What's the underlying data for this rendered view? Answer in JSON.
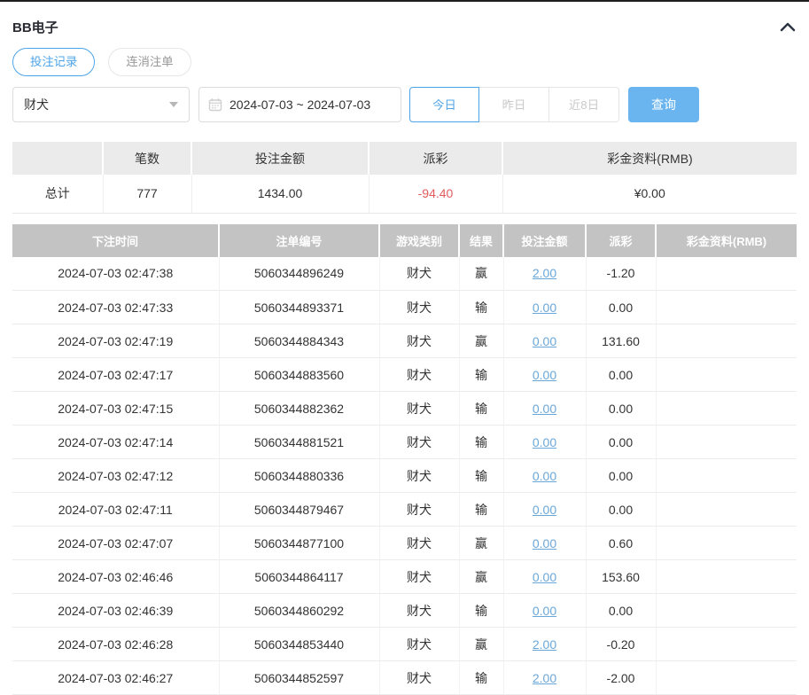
{
  "panel": {
    "title": "BB电子",
    "collapse_icon": "chevron-up-icon"
  },
  "tabs": [
    {
      "label": "投注记录",
      "active": true
    },
    {
      "label": "连消注单",
      "active": false
    }
  ],
  "filters": {
    "game_select": {
      "value": "财犬",
      "icon": "caret-down-icon"
    },
    "date_range": {
      "value": "2024-07-03 ~ 2024-07-03",
      "icon": "calendar-icon"
    },
    "quick_ranges": [
      {
        "label": "今日",
        "active": true
      },
      {
        "label": "昨日",
        "active": false
      },
      {
        "label": "近8日",
        "active": false
      }
    ],
    "search_button_label": "查询"
  },
  "summary": {
    "headers": [
      "",
      "笔数",
      "投注金额",
      "派彩",
      "彩金资料(RMB)"
    ],
    "row": {
      "label": "总计",
      "count": "777",
      "bet_amount": "1434.00",
      "payout": "-94.40",
      "bonus": "¥0.00"
    }
  },
  "records": {
    "headers": [
      "下注时间",
      "注单编号",
      "游戏类别",
      "结果",
      "投注金额",
      "派彩",
      "彩金资料(RMB)"
    ],
    "rows": [
      {
        "time": "2024-07-03 02:47:38",
        "order_id": "5060344896249",
        "game": "财犬",
        "result": "赢",
        "bet_amount": "2.00",
        "payout": "-1.20",
        "bonus": ""
      },
      {
        "time": "2024-07-03 02:47:33",
        "order_id": "5060344893371",
        "game": "财犬",
        "result": "输",
        "bet_amount": "0.00",
        "payout": "0.00",
        "bonus": ""
      },
      {
        "time": "2024-07-03 02:47:19",
        "order_id": "5060344884343",
        "game": "财犬",
        "result": "赢",
        "bet_amount": "0.00",
        "payout": "131.60",
        "bonus": ""
      },
      {
        "time": "2024-07-03 02:47:17",
        "order_id": "5060344883560",
        "game": "财犬",
        "result": "输",
        "bet_amount": "0.00",
        "payout": "0.00",
        "bonus": ""
      },
      {
        "time": "2024-07-03 02:47:15",
        "order_id": "5060344882362",
        "game": "财犬",
        "result": "输",
        "bet_amount": "0.00",
        "payout": "0.00",
        "bonus": ""
      },
      {
        "time": "2024-07-03 02:47:14",
        "order_id": "5060344881521",
        "game": "财犬",
        "result": "输",
        "bet_amount": "0.00",
        "payout": "0.00",
        "bonus": ""
      },
      {
        "time": "2024-07-03 02:47:12",
        "order_id": "5060344880336",
        "game": "财犬",
        "result": "输",
        "bet_amount": "0.00",
        "payout": "0.00",
        "bonus": ""
      },
      {
        "time": "2024-07-03 02:47:11",
        "order_id": "5060344879467",
        "game": "财犬",
        "result": "输",
        "bet_amount": "0.00",
        "payout": "0.00",
        "bonus": ""
      },
      {
        "time": "2024-07-03 02:47:07",
        "order_id": "5060344877100",
        "game": "财犬",
        "result": "赢",
        "bet_amount": "0.00",
        "payout": "0.60",
        "bonus": ""
      },
      {
        "time": "2024-07-03 02:46:46",
        "order_id": "5060344864117",
        "game": "财犬",
        "result": "赢",
        "bet_amount": "0.00",
        "payout": "153.60",
        "bonus": ""
      },
      {
        "time": "2024-07-03 02:46:39",
        "order_id": "5060344860292",
        "game": "财犬",
        "result": "输",
        "bet_amount": "0.00",
        "payout": "0.00",
        "bonus": ""
      },
      {
        "time": "2024-07-03 02:46:28",
        "order_id": "5060344853440",
        "game": "财犬",
        "result": "赢",
        "bet_amount": "2.00",
        "payout": "-0.20",
        "bonus": ""
      },
      {
        "time": "2024-07-03 02:46:27",
        "order_id": "5060344852597",
        "game": "财犬",
        "result": "输",
        "bet_amount": "2.00",
        "payout": "-2.00",
        "bonus": ""
      }
    ]
  },
  "colors": {
    "accent_blue": "#4da4e8",
    "search_button_blue": "#6ab5ef",
    "link_blue": "#6aa7d9",
    "negative_red": "#e25c5c",
    "table_header_gray": "#c3c3c3",
    "summary_header_gray": "#ebebeb",
    "text": "#333333"
  }
}
